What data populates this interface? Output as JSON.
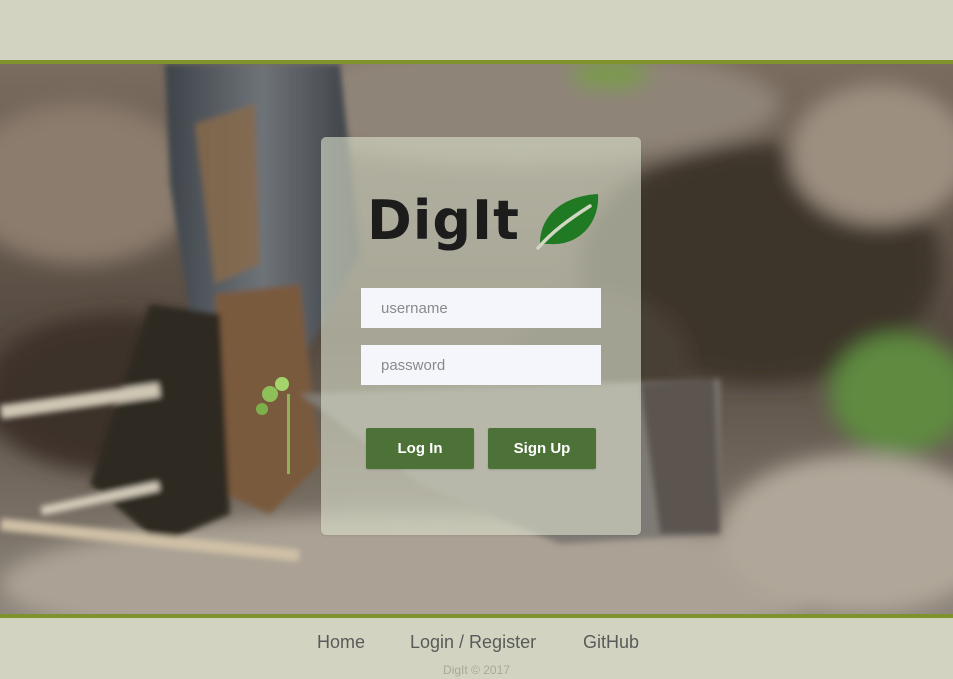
{
  "brand": {
    "name": "DigIt",
    "logo_icon": "leaf-icon"
  },
  "login_form": {
    "username_placeholder": "username",
    "password_placeholder": "password",
    "login_label": "Log In",
    "signup_label": "Sign Up"
  },
  "footer": {
    "nav": [
      {
        "label": "Home"
      },
      {
        "label": "Login / Register"
      },
      {
        "label": "GitHub"
      }
    ],
    "copyright": "DigIt © 2017"
  },
  "colors": {
    "accent": "#7f922c",
    "button": "#4c7237",
    "leaf": "#1f7a23",
    "background": "#d2d4c1"
  }
}
